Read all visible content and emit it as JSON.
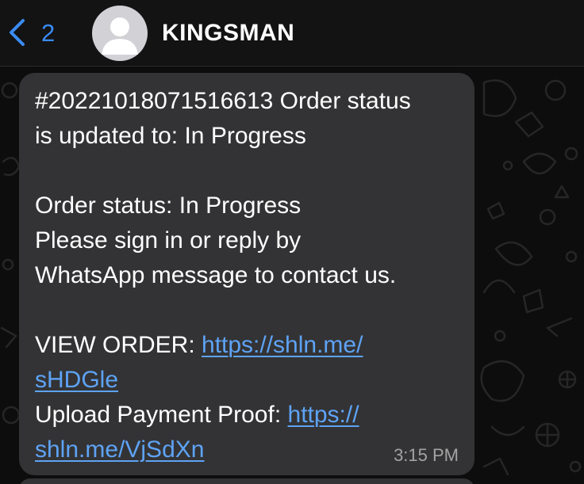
{
  "header": {
    "back_count": "2",
    "contact_name": "KINGSMAN"
  },
  "message": {
    "lines": [
      "#20221018071516613 Order status",
      "is updated to: In Progress",
      "Order status: In Progress",
      "Please sign in or reply by",
      "WhatsApp message to contact us."
    ],
    "view_order_label": "VIEW ORDER: ",
    "view_order_link_part1": "https://shln.me/",
    "view_order_link_part2": "sHDGle",
    "upload_label": "Upload Payment Proof: ",
    "upload_link_part1": "https://",
    "upload_link_part2": "shln.me/VjSdXn",
    "timestamp": "3:15 PM"
  },
  "colors": {
    "accent": "#3b8cf5",
    "link": "#5ea3f5",
    "bubble": "#333335",
    "background": "#0d0d0d"
  },
  "icons": {
    "back": "chevron-left-icon",
    "avatar": "person-silhouette-icon"
  }
}
